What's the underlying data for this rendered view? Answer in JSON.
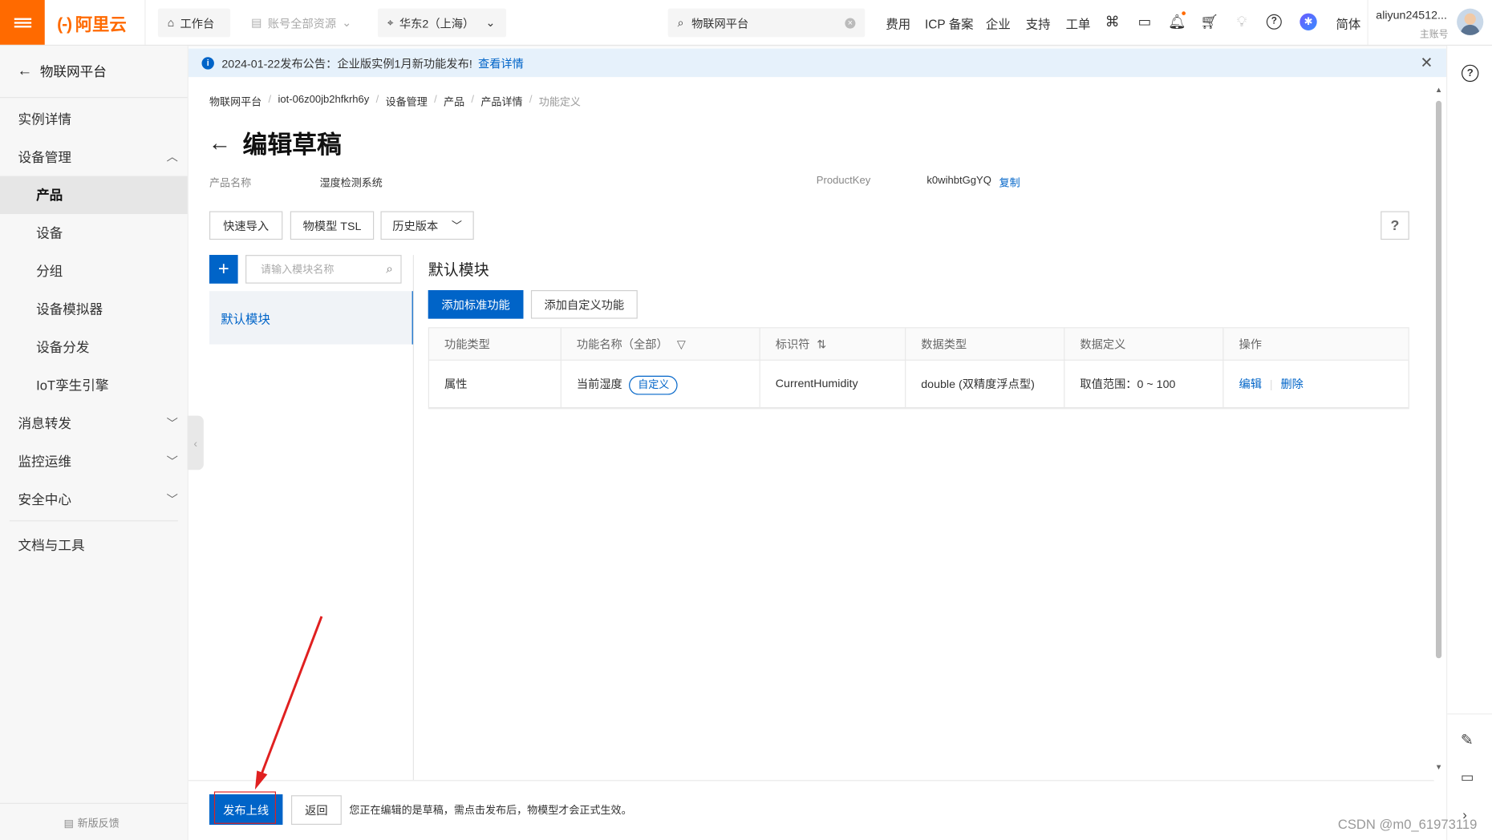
{
  "topbar": {
    "logo_text": "阿里云",
    "workbench": "工作台",
    "resources": "账号全部资源",
    "region": "华东2（上海）",
    "search_value": "物联网平台",
    "links": [
      "费用",
      "ICP 备案",
      "企业",
      "支持",
      "工单"
    ],
    "lang": "简体",
    "username": "aliyun24512...",
    "account_type": "主账号",
    "accent": "#ff6a00"
  },
  "sidebar": {
    "back_title": "物联网平台",
    "items": [
      {
        "label": "实例详情"
      },
      {
        "label": "设备管理"
      },
      {
        "label": "产品"
      },
      {
        "label": "设备"
      },
      {
        "label": "分组"
      },
      {
        "label": "设备模拟器"
      },
      {
        "label": "设备分发"
      },
      {
        "label": "IoT孪生引擎"
      },
      {
        "label": "消息转发"
      },
      {
        "label": "监控运维"
      },
      {
        "label": "安全中心"
      },
      {
        "label": "文档与工具"
      }
    ],
    "feedback": "新版反馈"
  },
  "notice": {
    "text": "2024-01-22发布公告：企业版实例1月新功能发布!",
    "link": "查看详情"
  },
  "breadcrumb": [
    "物联网平台",
    "iot-06z00jb2hfkrh6y",
    "设备管理",
    "产品",
    "产品详情",
    "功能定义"
  ],
  "page": {
    "title": "编辑草稿",
    "product_name_label": "产品名称",
    "product_name": "湿度检测系统",
    "product_key_label": "ProductKey",
    "product_key": "k0wihbtGgYQ",
    "copy": "复制"
  },
  "toolbar": {
    "quick_import": "快速导入",
    "tsl": "物模型 TSL",
    "history": "历史版本"
  },
  "module": {
    "search_placeholder": "请输入模块名称",
    "add": "+",
    "default_module": "默认模块",
    "section_title": "默认模块",
    "add_standard": "添加标准功能",
    "add_custom": "添加自定义功能"
  },
  "table": {
    "headers": [
      "功能类型",
      "功能名称（全部）",
      "标识符",
      "数据类型",
      "数据定义",
      "操作"
    ],
    "rows": [
      {
        "type": "属性",
        "name": "当前湿度",
        "tag": "自定义",
        "identifier": "CurrentHumidity",
        "data_type": "double (双精度浮点型)",
        "definition": "取值范围：0 ~ 100",
        "edit": "编辑",
        "delete": "删除"
      }
    ]
  },
  "footer": {
    "publish": "发布上线",
    "back": "返回",
    "hint": "您正在编辑的是草稿，需点击发布后，物模型才会正式生效。"
  },
  "watermark": "CSDN @m0_61973119",
  "colors": {
    "primary": "#0064c8",
    "annotation": "#e02020"
  }
}
